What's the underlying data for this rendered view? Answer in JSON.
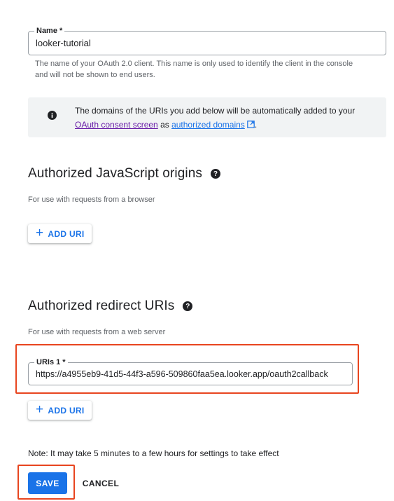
{
  "name_field": {
    "label": "Name *",
    "value": "looker-tutorial",
    "helper": "The name of your OAuth 2.0 client. This name is only used to identify the client in the console and will not be shown to end users."
  },
  "notice": {
    "icon": "info-icon",
    "text_before": "The domains of the URIs you add below will be automatically added to your ",
    "link_consent": "OAuth consent screen",
    "text_middle": " as ",
    "link_domains": "authorized domains",
    "text_after": "."
  },
  "js_origins": {
    "title": "Authorized JavaScript origins",
    "subtitle": "For use with requests from a browser",
    "add_label": "ADD URI"
  },
  "redirect_uris": {
    "title": "Authorized redirect URIs",
    "subtitle": "For use with requests from a web server",
    "uri_label": "URIs 1 *",
    "uri_value": "https://a4955eb9-41d5-44f3-a596-509860faa5ea.looker.app/oauth2callback",
    "add_label": "ADD URI"
  },
  "note": "Note: It may take 5 minutes to a few hours for settings to take effect",
  "actions": {
    "save": "SAVE",
    "cancel": "CANCEL"
  },
  "colors": {
    "accent": "#1a73e8",
    "highlight": "#e8451f",
    "link_visited": "#681da8"
  }
}
